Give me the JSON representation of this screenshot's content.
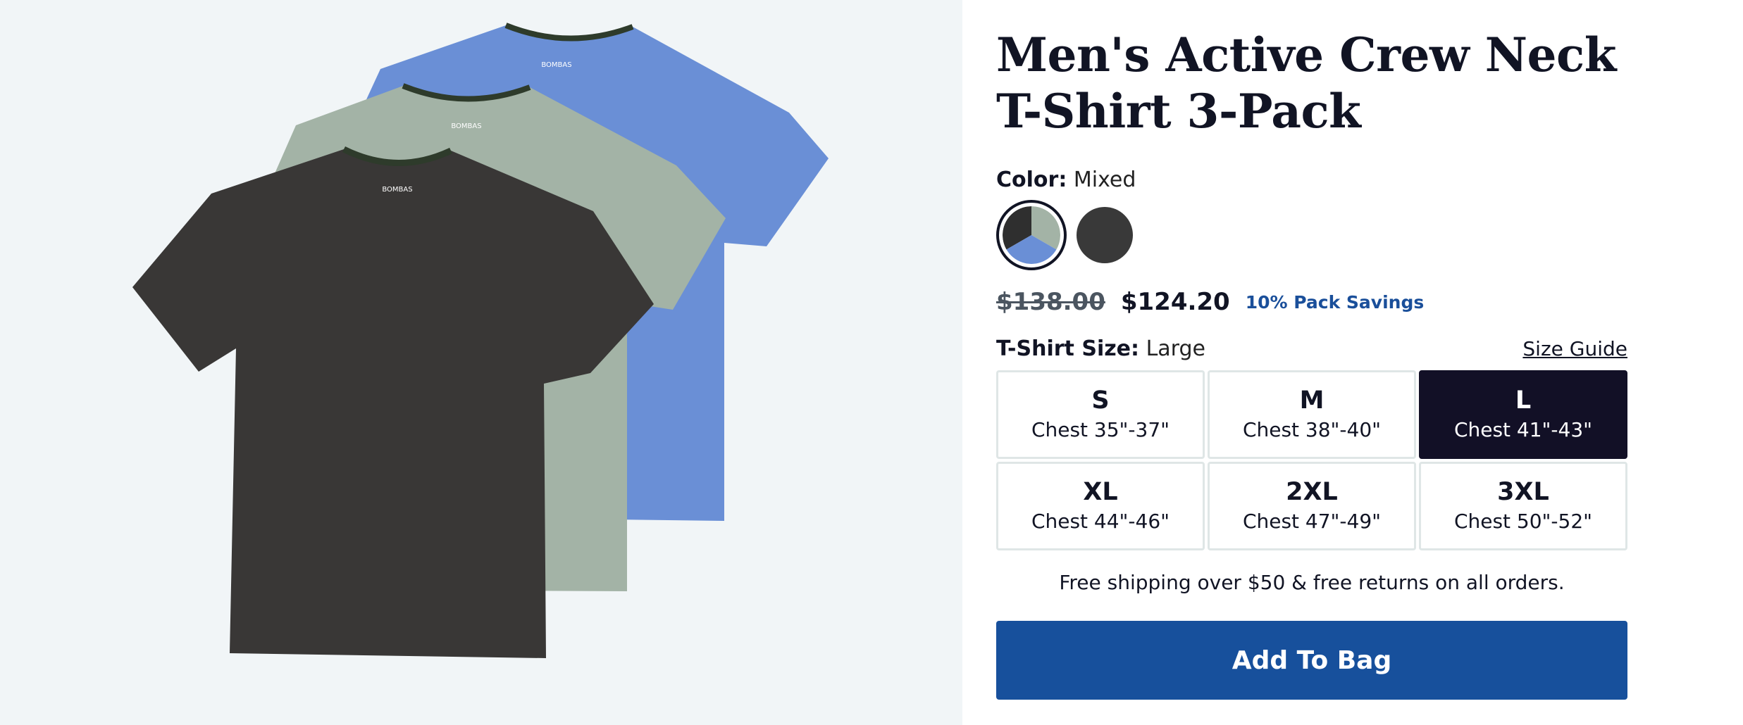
{
  "product": {
    "title": "Men's Active Crew Neck T-Shirt 3-Pack",
    "image_alt": "Three crew neck t-shirts in charcoal, sage green and blue"
  },
  "color": {
    "label": "Color:",
    "value": "Mixed",
    "swatches": [
      {
        "name": "mixed",
        "colors": [
          "#2f2f2f",
          "#a3b3a6",
          "#6a8fd6"
        ],
        "selected": true
      },
      {
        "name": "charcoal",
        "colors": [
          "#393939"
        ],
        "selected": false
      }
    ]
  },
  "pricing": {
    "original": "$138.00",
    "sale": "$124.20",
    "savings": "10% Pack Savings"
  },
  "size": {
    "label": "T-Shirt Size:",
    "value": "Large",
    "guide_label": "Size Guide",
    "options": [
      {
        "name": "S",
        "chest": "Chest 35\"-37\"",
        "selected": false
      },
      {
        "name": "M",
        "chest": "Chest 38\"-40\"",
        "selected": false
      },
      {
        "name": "L",
        "chest": "Chest 41\"-43\"",
        "selected": true
      },
      {
        "name": "XL",
        "chest": "Chest 44\"-46\"",
        "selected": false
      },
      {
        "name": "2XL",
        "chest": "Chest 47\"-49\"",
        "selected": false
      },
      {
        "name": "3XL",
        "chest": "Chest 50\"-52\"",
        "selected": false
      }
    ]
  },
  "shipping_note": "Free shipping over $50 & free returns on all orders.",
  "cta": {
    "add_to_bag": "Add To Bag"
  },
  "colors": {
    "brand_blue": "#17509c",
    "selected_dark": "#121026",
    "savings_blue": "#1a4f9a",
    "shirt_blue": "#6a8fd6",
    "shirt_green": "#a3b3a6",
    "shirt_charcoal": "#393736"
  }
}
